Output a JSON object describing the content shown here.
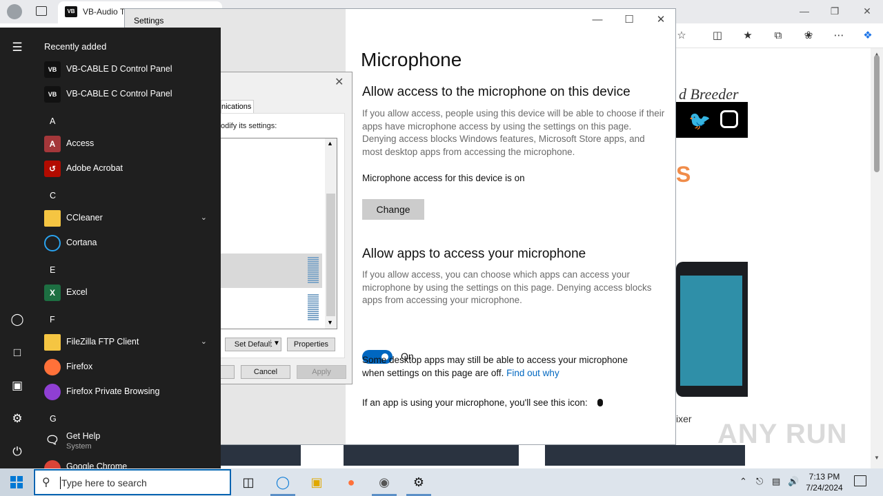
{
  "browser": {
    "tab_title": "VB-Audio Tha...",
    "page_breeder_text": "d Breeder",
    "page_orange_text": "S",
    "mixer_text": "ixer",
    "watermark": "ANY RUN"
  },
  "settings": {
    "window_title": "Settings",
    "page_title": "Microphone",
    "section1_title": "Allow access to the microphone on this device",
    "section1_desc": "If you allow access, people using this device will be able to choose if their apps have microphone access by using the settings on this page. Denying access blocks Windows features, Microsoft Store apps, and most desktop apps from accessing the microphone.",
    "device_status": "Microphone access for this device is on",
    "change_button": "Change",
    "section2_title": "Allow apps to access your microphone",
    "section2_desc": "If you allow access, you can choose which apps can access your microphone by using the settings on this page. Denying access blocks apps from accessing your microphone.",
    "toggle_state": "On",
    "toggle_on": true,
    "desktop_note": "Some desktop apps may still be able to access your microphone when settings on this page are off.",
    "find_out_link": "Find out why",
    "icon_note": "If an app is using your microphone, you'll see this icon:",
    "accent_color": "#0067c0"
  },
  "sound_dialog": {
    "tab_label": "nications",
    "hint": "odify its settings:",
    "set_default": "Set Default",
    "properties": "Properties",
    "cancel": "Cancel",
    "apply": "Apply"
  },
  "start_menu": {
    "recently_added_label": "Recently added",
    "recent_apps": [
      {
        "label": "VB-CABLE D Control Panel"
      },
      {
        "label": "VB-CABLE C Control Panel"
      }
    ],
    "letters": [
      "A",
      "C",
      "E",
      "F",
      "G"
    ],
    "apps": {
      "access": "Access",
      "acrobat": "Adobe Acrobat",
      "ccleaner": "CCleaner",
      "cortana": "Cortana",
      "excel": "Excel",
      "filezilla": "FileZilla FTP Client",
      "firefox": "Firefox",
      "firefox_private": "Firefox Private Browsing",
      "get_help": "Get Help",
      "get_help_sub": "System",
      "chrome": "Google Chrome"
    }
  },
  "taskbar": {
    "search_placeholder": "Type here to search",
    "time": "7:13 PM",
    "date": "7/24/2024"
  }
}
